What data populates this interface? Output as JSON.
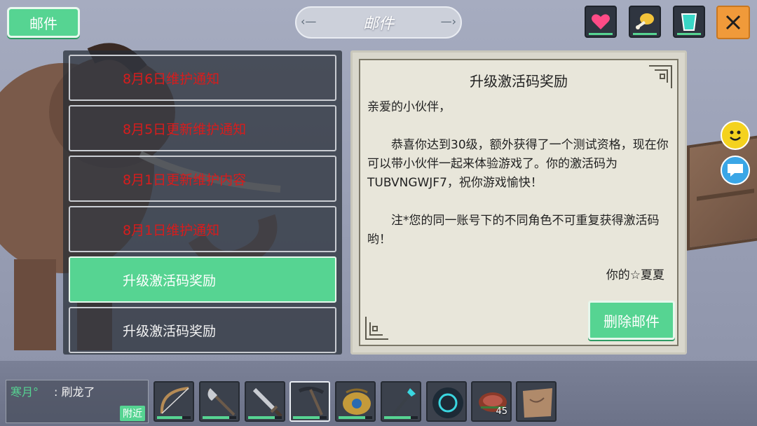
{
  "header": {
    "mail_tab_label": "邮件",
    "title": "邮件",
    "buttons": [
      {
        "name": "heart-icon",
        "color": "#ff4b86"
      },
      {
        "name": "meat-icon",
        "color": "#f3c33a"
      },
      {
        "name": "water-cup-icon",
        "color": "#39d6c6"
      }
    ],
    "close_icon": "close-icon"
  },
  "mail_list": {
    "items": [
      {
        "title": "8月6日维护通知",
        "state": "unread"
      },
      {
        "title": "8月5日更新维护通知",
        "state": "unread"
      },
      {
        "title": "8月1日更新维护内容",
        "state": "unread"
      },
      {
        "title": "8月1日维护通知",
        "state": "unread"
      },
      {
        "title": "升级激活码奖励",
        "state": "selected"
      },
      {
        "title": "升级激活码奖励",
        "state": "read"
      }
    ]
  },
  "mail": {
    "title": "升级激活码奖励",
    "greeting": "亲爱的小伙伴，",
    "paragraph1": "恭喜你达到30级，额外获得了一个测试资格，现在你可以带小伙伴一起来体验游戏了。你的激活码为TUBVNGWJF7，祝你游戏愉快！",
    "paragraph2": "注*您的同一账号下的不同角色不可重复获得激活码哟！",
    "signature": "你的☆夏夏",
    "delete_label": "删除邮件"
  },
  "side_buttons": [
    {
      "name": "emoji-smile-icon",
      "color": "#f4d21e"
    },
    {
      "name": "chat-bubble-icon",
      "color": "#3aa6e6"
    }
  ],
  "chat": {
    "sender": "寒月°",
    "message": ": 刷龙了",
    "scope": "附近"
  },
  "hotbar": {
    "slots": [
      {
        "name": "bow-icon",
        "durability": 0.75
      },
      {
        "name": "axe-icon",
        "durability": 0.8
      },
      {
        "name": "sword-icon",
        "durability": 0.8
      },
      {
        "name": "pickaxe-icon",
        "durability": 0.8,
        "active": true
      },
      {
        "name": "horn-pouch-icon",
        "durability": 0.8
      },
      {
        "name": "crystal-staff-icon",
        "durability": 0.8
      },
      {
        "name": "rune-orb-icon",
        "durability": null
      },
      {
        "name": "steak-icon",
        "count": "45"
      },
      {
        "name": "map-scroll-icon"
      }
    ]
  }
}
